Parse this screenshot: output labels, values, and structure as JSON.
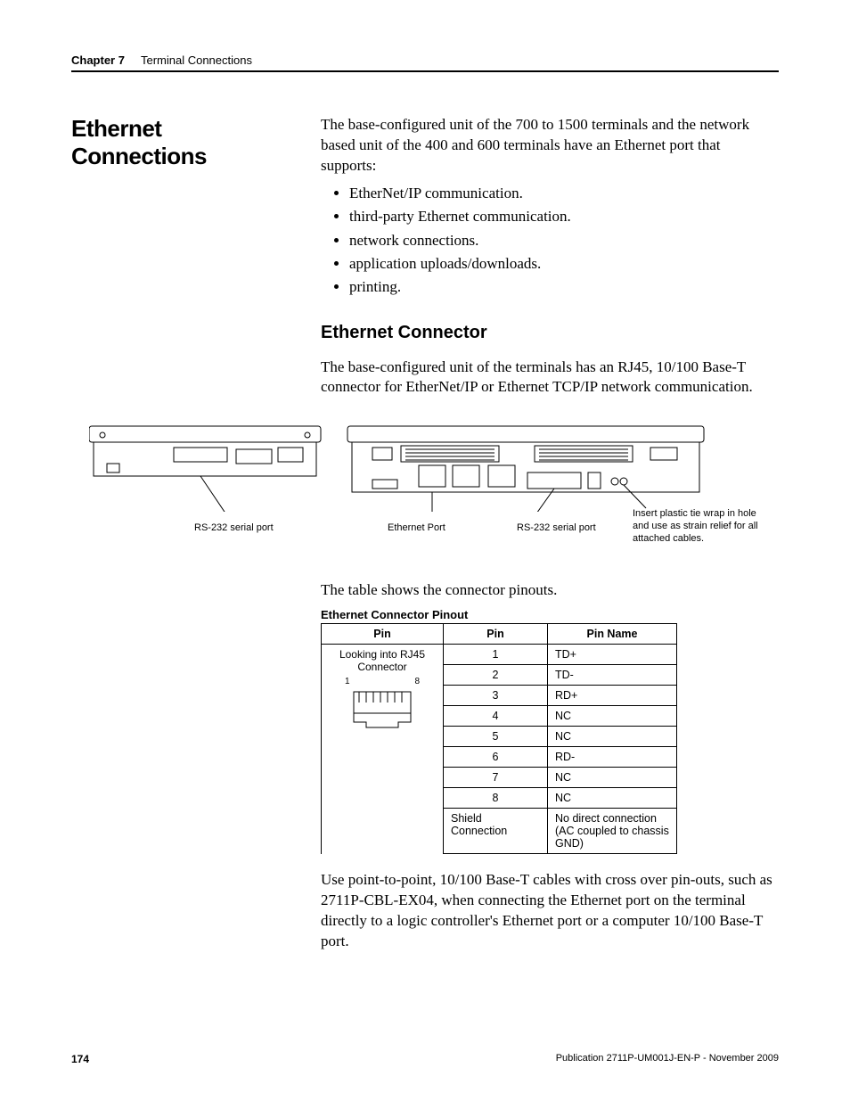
{
  "header": {
    "chapter": "Chapter 7",
    "title": "Terminal Connections"
  },
  "section_title": "Ethernet Connections",
  "intro": "The base-configured unit of the 700 to 1500 terminals and the network based unit of the 400 and 600 terminals have an Ethernet port that supports:",
  "bullets": [
    "EtherNet/IP communication.",
    "third-party Ethernet communication.",
    "network connections.",
    "application uploads/downloads.",
    "printing."
  ],
  "subheading": "Ethernet Connector",
  "sub_para": "The base-configured unit of the terminals has an RJ45, 10/100 Base-T connector for EtherNet/IP or Ethernet TCP/IP network communication.",
  "diagram_labels": {
    "rs232_left": "RS-232 serial port",
    "ethernet_port": "Ethernet Port",
    "rs232_right": "RS-232 serial port",
    "tie_wrap": "Insert plastic tie wrap in hole and use as strain relief for all attached cables."
  },
  "table_intro": "The table shows the connector pinouts.",
  "table_caption": "Ethernet Connector Pinout",
  "table_headers": [
    "Pin",
    "Pin",
    "Pin Name"
  ],
  "rj_col_label": "Looking into RJ45 Connector",
  "rj_pin_labels": {
    "left": "1",
    "right": "8"
  },
  "chart_data": {
    "type": "table",
    "title": "Ethernet Connector Pinout",
    "columns": [
      "Pin",
      "Pin Name"
    ],
    "rows": [
      [
        "1",
        "TD+"
      ],
      [
        "2",
        "TD-"
      ],
      [
        "3",
        "RD+"
      ],
      [
        "4",
        "NC"
      ],
      [
        "5",
        "NC"
      ],
      [
        "6",
        "RD-"
      ],
      [
        "7",
        "NC"
      ],
      [
        "8",
        "NC"
      ],
      [
        "Shield Connection",
        "No direct connection (AC coupled to chassis GND)"
      ]
    ]
  },
  "closing_para": "Use point-to-point, 10/100 Base-T cables with cross over pin-outs, such as 2711P-CBL-EX04, when connecting the Ethernet port on the terminal directly to a logic controller's Ethernet port or a computer 10/100 Base-T port.",
  "footer": {
    "page_number": "174",
    "publication": "Publication 2711P-UM001J-EN-P - November 2009"
  }
}
